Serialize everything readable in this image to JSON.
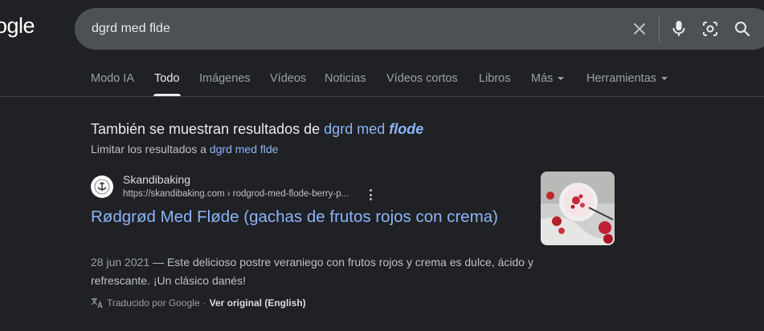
{
  "logo": {
    "text": "ogle"
  },
  "search": {
    "query": "dgrd med flde",
    "icons": [
      "close-icon",
      "microphone-icon",
      "lens-icon",
      "search-icon"
    ]
  },
  "tabs": [
    {
      "label": "Modo IA"
    },
    {
      "label": "Todo",
      "active": true
    },
    {
      "label": "Imágenes"
    },
    {
      "label": "Vídeos"
    },
    {
      "label": "Noticias"
    },
    {
      "label": "Vídeos cortos"
    },
    {
      "label": "Libros"
    },
    {
      "label": "Más"
    },
    {
      "label": "Herramientas"
    }
  ],
  "spelling": {
    "prefix": "También se muestran resultados de",
    "link_normal": "dgrd med",
    "link_bold": "flode",
    "limit_prefix": "Limitar los resultados a",
    "limit_link": "dgrd med flde"
  },
  "result": {
    "site_name": "Skandibaking",
    "url": "https://skandibaking.com › rodgrod-med-flode-berry-p...",
    "title": "Rødgrød Med Fløde (gachas de frutos rojos con crema)",
    "date": "28 jun 2021",
    "dash": "—",
    "snippet": "Este delicioso postre veraniego con frutos rojos y crema es dulce, ácido y refrescante. ¡Un clásico danés!",
    "translated_label": "Traducido por Google",
    "separator": "·",
    "view_original": "Ver original (English)"
  },
  "colors": {
    "background": "#202124",
    "search_box": "#4d5156",
    "link": "#8ab4f8",
    "text": "#bdc1c6"
  }
}
